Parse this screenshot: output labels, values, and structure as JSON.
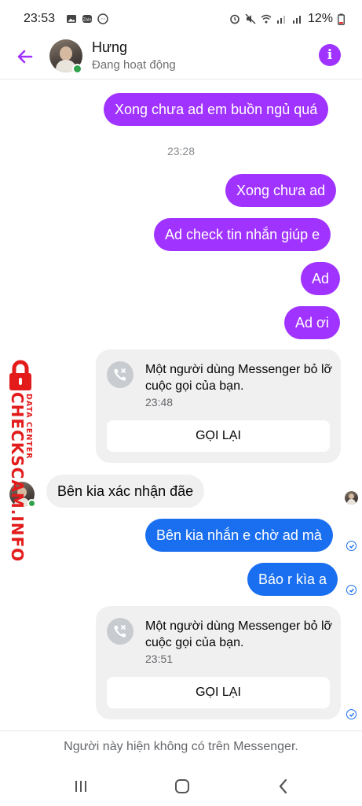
{
  "status_bar": {
    "time": "23:53",
    "battery": "12%"
  },
  "header": {
    "name": "Hưng",
    "status": "Đang hoạt động"
  },
  "messages": {
    "m1": "Xong chưa ad em buồn ngủ quá",
    "ts1": "23:28",
    "m2": "Xong chưa ad",
    "m3": "Ad check tin nhắn giúp e",
    "m4": "Ad",
    "m5": "Ad ơi",
    "call1": {
      "text": "Một người dùng Messenger bỏ lỡ cuộc gọi của bạn.",
      "time": "23:48",
      "button": "GỌI LẠI"
    },
    "r1": "Bên kia xác nhận đãe",
    "m6": "Bên kia nhắn e chờ ad mà",
    "m7": "Báo r kìa a",
    "call2": {
      "text": "Một người dùng Messenger bỏ lỡ cuộc gọi của bạn.",
      "time": "23:51",
      "button": "GỌI LẠI"
    }
  },
  "watermark": {
    "main": "CHECKSCAM.INFO",
    "sub": "DATA CENTER"
  },
  "footer": {
    "note": "Người này hiện không có trên Messenger."
  },
  "colors": {
    "accent": "#a033ff",
    "blue_bubble": "#1a6ff0",
    "online": "#31a24c",
    "watermark": "#e31b1b"
  },
  "icons": [
    "back-arrow-icon",
    "info-icon",
    "missed-call-icon",
    "read-receipt-icon",
    "lock-icon",
    "recent-apps-icon",
    "home-icon",
    "back-icon"
  ]
}
